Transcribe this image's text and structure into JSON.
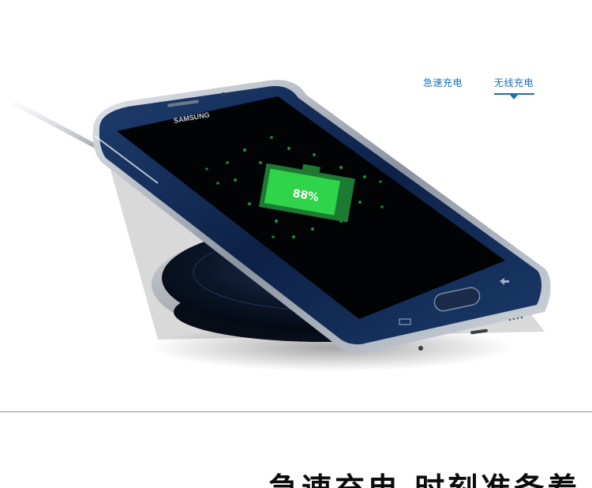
{
  "tabs": {
    "fast_label": "急速充电",
    "wireless_label": "无线充电",
    "active": "wireless",
    "accent_color": "#1a6fb6"
  },
  "phone": {
    "brand": "SAMSUNG",
    "battery_percent_label": "88%",
    "battery_level": 0.88,
    "battery_color": "#2fd44a"
  },
  "headline": {
    "text": "急速充电 时刻准备着"
  }
}
